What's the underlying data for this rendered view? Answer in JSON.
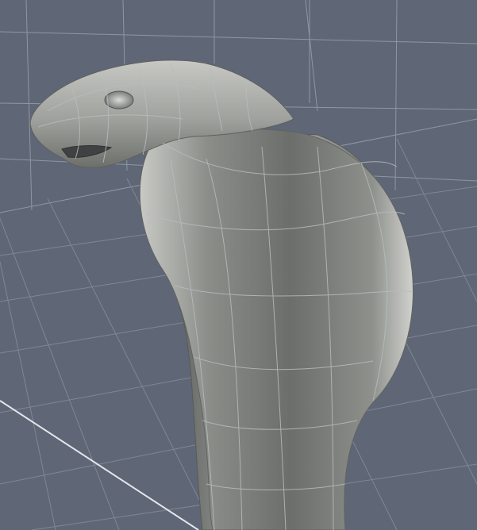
{
  "viewport": {
    "background_color": "#5f6675",
    "grid_color": "#8f96a4",
    "floor_line_color": "#7f8796",
    "axis_line_color": "#e3e6ec"
  },
  "model": {
    "name": "cobra",
    "base_color": "#8d8f8a",
    "wire_color": "#b8bcbc",
    "shadow_color": "#3f4142",
    "highlight_color": "#d9dad5"
  }
}
